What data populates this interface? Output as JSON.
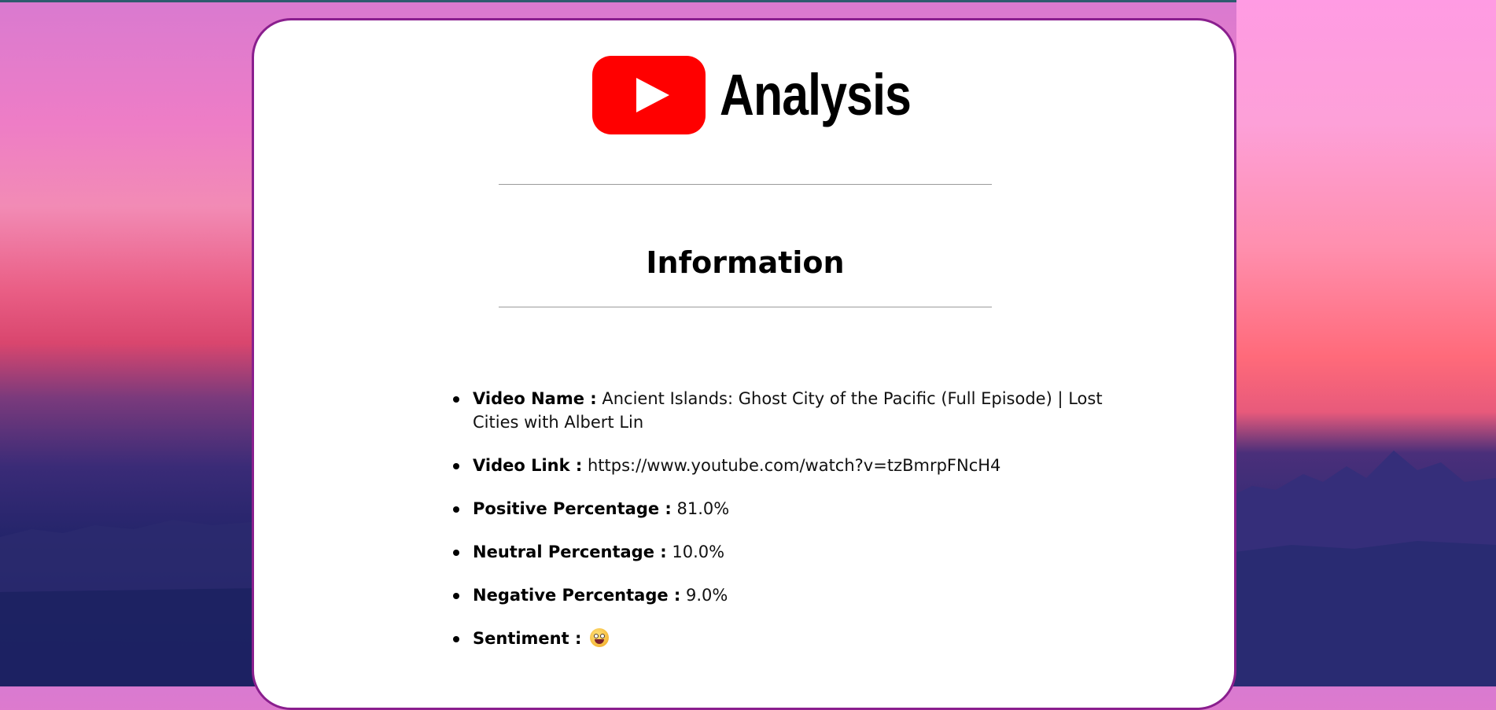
{
  "logo": {
    "text": "Analysis",
    "icon": "youtube-play-icon",
    "brand_color": "#ff0000"
  },
  "section": {
    "title": "Information"
  },
  "info": {
    "video_name_label": "Video Name :",
    "video_name_value": "Ancient Islands: Ghost City of the Pacific (Full Episode) | Lost Cities with Albert Lin",
    "video_link_label": "Video Link :",
    "video_link_value": "https://www.youtube.com/watch?v=tzBmrpFNcH4",
    "positive_label": "Positive Percentage :",
    "positive_value": "81.0%",
    "neutral_label": "Neutral Percentage :",
    "neutral_value": "10.0%",
    "negative_label": "Negative Percentage :",
    "negative_value": "9.0%",
    "sentiment_label": "Sentiment :",
    "sentiment_icon": "grinning-face-emoji-icon"
  },
  "colors": {
    "card_border": "#8a1f8e",
    "divider": "#9a9a9a"
  }
}
